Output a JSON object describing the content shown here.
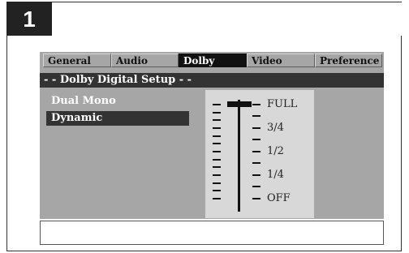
{
  "step_number": "1",
  "tabs": [
    {
      "label": "General",
      "active": false
    },
    {
      "label": "Audio",
      "active": false
    },
    {
      "label": "Dolby",
      "active": true
    },
    {
      "label": "Video",
      "active": false
    },
    {
      "label": "Preference",
      "active": false
    }
  ],
  "section_title": "- - Dolby Digital Setup - -",
  "options": [
    {
      "label": "Dual Mono",
      "selected": false
    },
    {
      "label": "Dynamic",
      "selected": true
    }
  ],
  "dynamic_range": {
    "levels": [
      "FULL",
      "3/4",
      "1/2",
      "1/4",
      "OFF"
    ],
    "current": "FULL"
  },
  "colors": {
    "screen_bg": "#a6a6a6",
    "panel_bg": "#d8d8d8",
    "highlight": "#333333",
    "active_tab": "#111111"
  }
}
